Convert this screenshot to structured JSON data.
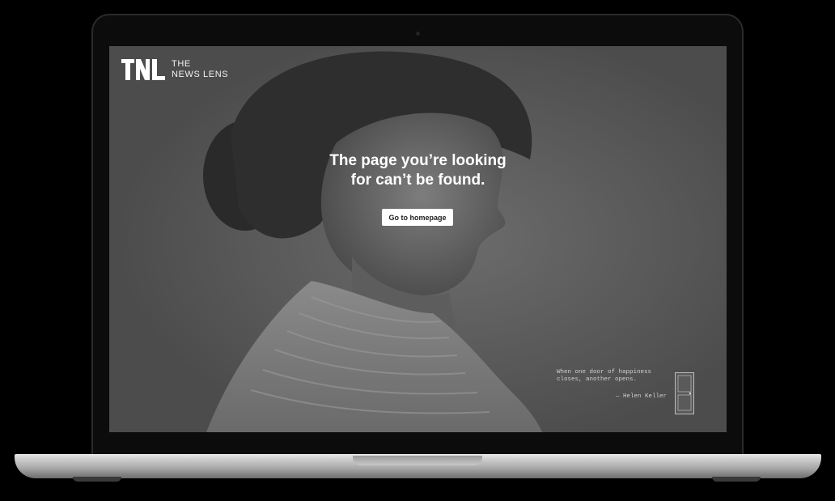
{
  "logo": {
    "line1": "THE",
    "line2": "NEWS LENS",
    "mark_icon": "tnl-logo-icon"
  },
  "error": {
    "line1": "The page you’re looking",
    "line2": "for can’t be found."
  },
  "home_button": {
    "label": "Go to homepage"
  },
  "quote": {
    "text": "When one door of happiness closes, another opens.",
    "author": "— Helen Keller",
    "icon": "door-icon"
  },
  "colors": {
    "screen_bg": "#4e4e4e",
    "text": "#ffffff",
    "button_bg": "#ffffff"
  }
}
